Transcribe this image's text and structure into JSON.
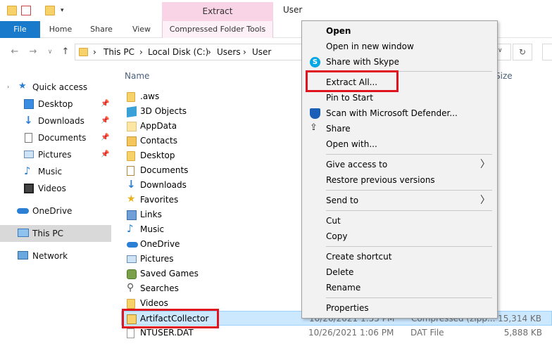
{
  "title_bar": {
    "contextual_group": "Extract",
    "window_title": "User"
  },
  "ribbon": {
    "tabs": [
      "File",
      "Home",
      "Share",
      "View",
      "Compressed Folder Tools"
    ]
  },
  "address": {
    "breadcrumbs": [
      "This PC",
      "Local Disk (C:)",
      "Users",
      "User"
    ]
  },
  "sidebar": {
    "items": [
      {
        "label": "Quick access",
        "icon": "star-icon"
      },
      {
        "label": "Desktop",
        "icon": "desktop-icon",
        "pinned": true
      },
      {
        "label": "Downloads",
        "icon": "download-arrow-icon",
        "pinned": true
      },
      {
        "label": "Documents",
        "icon": "documents-icon",
        "pinned": true
      },
      {
        "label": "Pictures",
        "icon": "pictures-icon",
        "pinned": true
      },
      {
        "label": "Music",
        "icon": "music-note-icon"
      },
      {
        "label": "Videos",
        "icon": "film-icon"
      },
      {
        "label": "OneDrive",
        "icon": "cloud-icon"
      },
      {
        "label": "This PC",
        "icon": "monitor-icon",
        "selected": true
      },
      {
        "label": "Network",
        "icon": "network-icon"
      }
    ],
    "pin_glyph": "📌"
  },
  "file_list": {
    "headers": {
      "name": "Name",
      "size": "Size"
    },
    "rows": [
      {
        "name": ".aws",
        "icon": "folder-icon"
      },
      {
        "name": "3D Objects",
        "icon": "cube-icon"
      },
      {
        "name": "AppData",
        "icon": "folder-icon"
      },
      {
        "name": "Contacts",
        "icon": "contacts-icon"
      },
      {
        "name": "Desktop",
        "icon": "folder-icon"
      },
      {
        "name": "Documents",
        "icon": "documents-icon"
      },
      {
        "name": "Downloads",
        "icon": "download-arrow-icon"
      },
      {
        "name": "Favorites",
        "icon": "star-icon"
      },
      {
        "name": "Links",
        "icon": "links-icon"
      },
      {
        "name": "Music",
        "icon": "music-note-icon"
      },
      {
        "name": "OneDrive",
        "icon": "cloud-icon"
      },
      {
        "name": "Pictures",
        "icon": "pictures-icon"
      },
      {
        "name": "Saved Games",
        "icon": "games-icon"
      },
      {
        "name": "Searches",
        "icon": "search-icon"
      },
      {
        "name": "Videos",
        "icon": "folder-icon"
      },
      {
        "name": "ArtifactCollector",
        "icon": "zip-folder-icon",
        "date": "10/26/2021 1:55 PM",
        "type": "Compressed (zipp...",
        "size": "15,314 KB",
        "selected": true
      },
      {
        "name": "NTUSER.DAT",
        "icon": "file-icon",
        "date": "10/26/2021 1:06 PM",
        "type": "DAT File",
        "size": "5,888 KB"
      }
    ]
  },
  "context_menu": {
    "items": [
      {
        "label": "Open",
        "bold": true
      },
      {
        "label": "Open in new window"
      },
      {
        "label": "Share with Skype",
        "icon": "skype-icon"
      },
      {
        "separator": true
      },
      {
        "label": "Extract All..."
      },
      {
        "label": "Pin to Start"
      },
      {
        "label": "Scan with Microsoft Defender...",
        "icon": "defender-shield-icon"
      },
      {
        "label": "Share",
        "icon": "share-icon"
      },
      {
        "label": "Open with..."
      },
      {
        "separator": true
      },
      {
        "label": "Give access to",
        "submenu": true
      },
      {
        "label": "Restore previous versions"
      },
      {
        "separator": true
      },
      {
        "label": "Send to",
        "submenu": true
      },
      {
        "separator": true
      },
      {
        "label": "Cut"
      },
      {
        "label": "Copy"
      },
      {
        "separator": true
      },
      {
        "label": "Create shortcut"
      },
      {
        "label": "Delete"
      },
      {
        "label": "Rename"
      },
      {
        "separator": true
      },
      {
        "label": "Properties"
      }
    ],
    "submenu_glyph": "〉"
  },
  "colors": {
    "accent": "#1979ca",
    "selection": "#cce8ff",
    "highlight_box": "#e0141e",
    "contextual_tab": "#f9d3e6"
  }
}
